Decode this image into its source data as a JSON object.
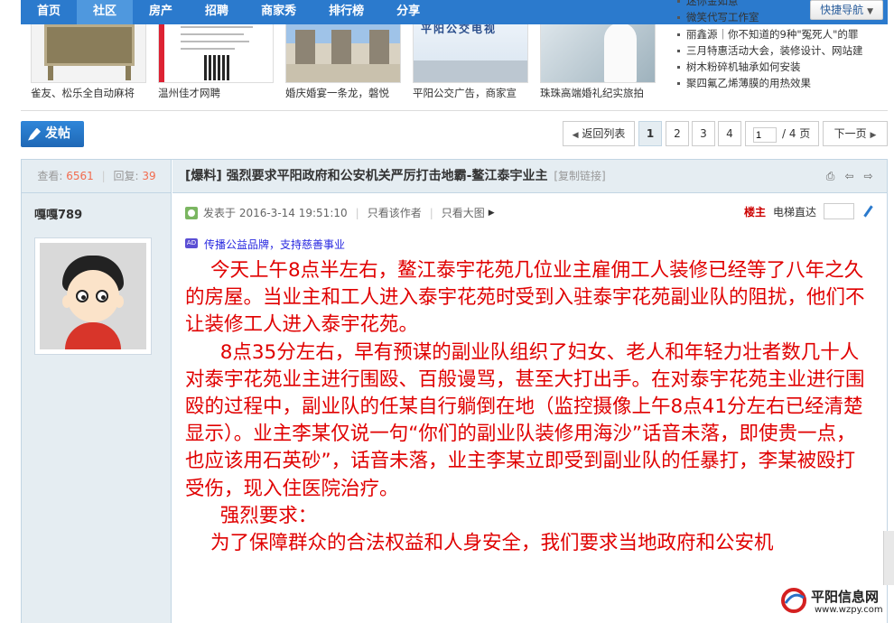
{
  "nav": {
    "items": [
      "首页",
      "社区",
      "房产",
      "招聘",
      "商家秀",
      "排行榜",
      "分享"
    ],
    "active_index": 1,
    "quick_nav": "快捷导航"
  },
  "thumbnails": [
    {
      "caption": "雀友、松乐全自动麻将"
    },
    {
      "caption": "温州佳才网聘"
    },
    {
      "caption": "婚庆婚宴一条龙，磐悦"
    },
    {
      "caption": "平阳公交广告，商家宣",
      "sign_text": "平阳公交电视"
    },
    {
      "caption": "珠珠高端婚礼纪实旅拍"
    }
  ],
  "headlines": [
    "迷你金如意",
    "微笑代写工作室",
    "丽鑫源｜你不知道的9种\"冤死人\"的罪",
    "三月特惠活动大会，装修设计、网站建",
    "树木粉碎机轴承如何安装",
    "聚四氟乙烯薄膜的用热效果"
  ],
  "toolbar": {
    "post_button": "发帖",
    "back_to_list": "返回列表",
    "pages": [
      "1",
      "2",
      "3",
      "4"
    ],
    "current_page": 1,
    "page_input": "1",
    "page_total": "/ 4 页",
    "next_page": "下一页"
  },
  "thread": {
    "views_label": "查看:",
    "views": "6561",
    "replies_label": "回复:",
    "replies": "39",
    "title_tag": "[爆料]",
    "title": "强烈要求平阳政府和公安机关严厉打击地霸-鳌江泰宇业主",
    "copy_link": "[复制链接]"
  },
  "post": {
    "author": "嘎嘎789",
    "posted_at": "发表于 2016-3-14 19:51:10",
    "only_author": "只看该作者",
    "view_large_image": "只看大图",
    "floor_label": "楼主",
    "elevator_label": "电梯直达",
    "ad_text": "传播公益品牌，支持慈善事业",
    "paragraphs": [
      "今天上午8点半左右，鳌江泰宇花苑几位业主雇佣工人装修已经等了八年之久的房屋。当业主和工人进入泰宇花苑时受到入驻泰宇花苑副业队的阻扰，他们不让装修工人进入泰宇花苑。",
      "8点35分左右，早有预谋的副业队组织了妇女、老人和年轻力壮者数几十人对泰宇花苑业主进行围殴、百般谩骂，甚至大打出手。在对泰宇花苑主业进行围殴的过程中，副业队的任某自行躺倒在地（监控摄像上午8点41分左右已经清楚显示）。业主李某仅说一句“你们的副业队装修用海沙”话音未落，即使贵一点，也应该用石英砂”，话音未落，业主李某立即受到副业队的任暴打，李某被殴打受伤，现入住医院治疗。",
      "强烈要求：",
      "为了保障群众的合法权益和人身安全，我们要求当地政府和公安机"
    ]
  },
  "watermark": {
    "title": "平阳信息网",
    "url": "www.wzpy.com"
  }
}
